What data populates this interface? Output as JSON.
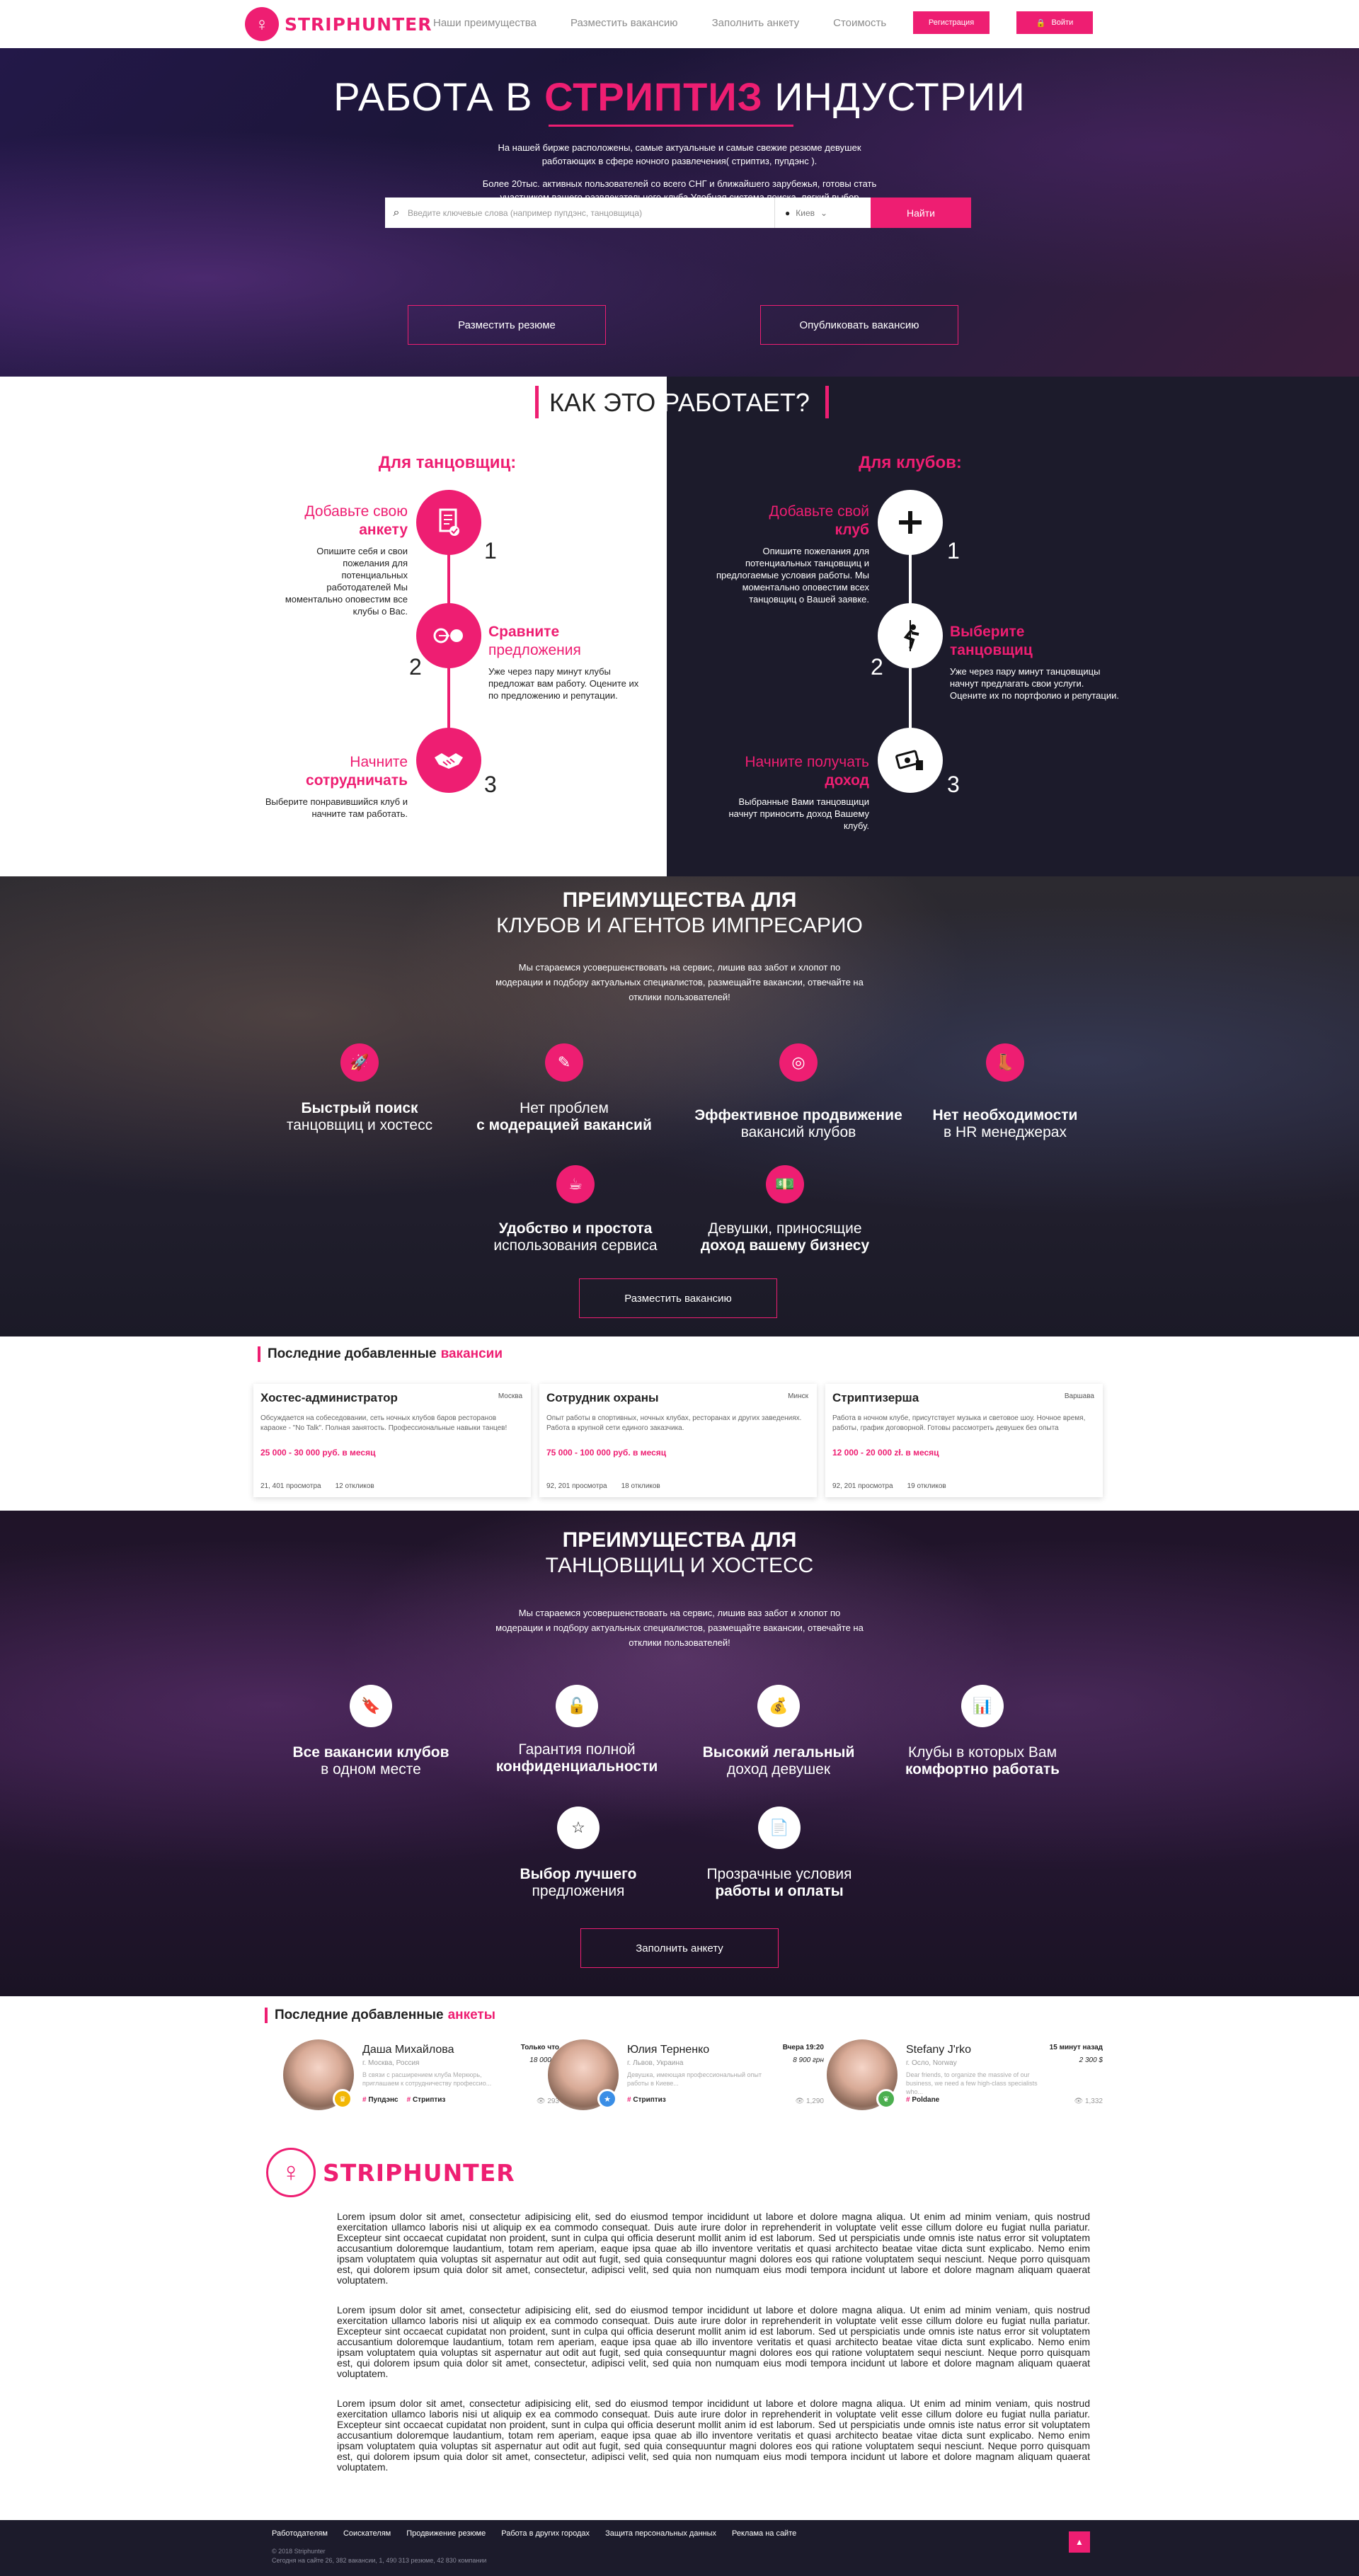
{
  "header": {
    "logo": "STRIPHUNTER",
    "nav": [
      "Наши преимущества",
      "Разместить вакансию",
      "Заполнить анкету",
      "Стоимость"
    ],
    "register": "Регистрация",
    "login": "Войти"
  },
  "hero": {
    "title_pre": "РАБОТА В",
    "title_accent": "СТРИПТИЗ",
    "title_post": "ИНДУСТРИИ",
    "p1": "На нашей бирже расположены, самые актуальные и самые свежие резюме девушек работающих в сфере ночного развлечения( стриптиз, пупдэнс ).",
    "p2": "Более 20тыс. активных пользователей со всего СНГ и ближайшего зарубежья, готовы стать участником вашего развлекательного клуба.Удобная система поиска, легкий выбор специалистов, доступная цена!",
    "search_placeholder": "Введите ключевые слова (например пупдэнс, танцовщица)",
    "city": "Киев",
    "search_button": "Найти",
    "btn_resume": "Разместить резюме",
    "btn_vacancy": "Опубликовать вакансию"
  },
  "how": {
    "title_left": "КАК ЭТО",
    "title_right": "РАБОТАЕТ?",
    "dancers_head": "Для танцовщиц:",
    "clubs_head": "Для клубов:",
    "dancers": [
      {
        "num": "1",
        "h1": "Добавьте свою",
        "h2": "анкету",
        "desc": "Опишите себя и свои пожелания для потенциальных работодателей Мы моментально оповестим все клубы о Вас."
      },
      {
        "num": "2",
        "h1": "Сравните",
        "h2": "предложения",
        "desc": "Уже через пару минут клубы предложат вам работу. Оцените их по предложению и репутации."
      },
      {
        "num": "3",
        "h1": "Начните",
        "h2": "сотрудничать",
        "desc": "Выберите понравившийся клуб и начните там работать."
      }
    ],
    "clubs": [
      {
        "num": "1",
        "h1": "Добавьте свой",
        "h2": "клуб",
        "desc": "Опишите пожелания для потенциальных танцовщиц и предлогаемые условия работы. Мы моментально оповестим всех танцовщиц о Вашей заявке."
      },
      {
        "num": "2",
        "h1": "Выберите",
        "h2": "танцовщиц",
        "desc": "Уже через пару минут танцовщицы начнут предлагать свои услуги. Оцените их по портфолио и репутации."
      },
      {
        "num": "3",
        "h1": "Начните получать",
        "h2": "доход",
        "desc": "Выбранные Вами танцовщици начнут приносить доход Вашему клубу."
      }
    ]
  },
  "adv_clubs": {
    "title_bold": "ПРЕИМУЩЕСТВА ДЛЯ",
    "title_light": "КЛУБОВ И АГЕНТОВ ИМПРЕСАРИО",
    "text": "Мы стараемся усовершенствовать на сервис, лишив ваз забот и хлопот по модерации и подбору актуальных специалистов, размещайте вакансии, отвечайте на отклики пользователей!",
    "features": [
      {
        "icon": "rocket-icon",
        "a": "Быстрый поиск",
        "b": "танцовщиц и хостесс"
      },
      {
        "icon": "pencil-icon",
        "a": "Нет проблем",
        "b": "с модерацией вакансий"
      },
      {
        "icon": "target-icon",
        "a": "Эффективное продвижение",
        "b": "вакансий клубов"
      },
      {
        "icon": "boot-icon",
        "a": "Нет необходимости",
        "b": "в HR менеджерах"
      },
      {
        "icon": "cup-icon",
        "a": "Удобство и простота",
        "b": "использования сервиса"
      },
      {
        "icon": "money-icon",
        "a": "Девушки, приносящие",
        "b": "доход вашему бизнесу"
      }
    ],
    "button": "Разместить вакансию"
  },
  "vacancies": {
    "head": "Последние добавленные",
    "head_accent": "вакансии",
    "items": [
      {
        "title": "Хостес-администратор",
        "city": "Москва",
        "desc": "Обсуждается на собеседовании, сеть ночных клубов баров ресторанов караоке - \"No Talk\". Полная занятость. Профессиональные навыки танцев!",
        "salary": "25 000 - 30 000 руб. в месяц",
        "views": "21, 401 просмотра",
        "replies": "12 откликов"
      },
      {
        "title": "Сотрудник охраны",
        "city": "Минск",
        "desc": "Опыт работы в спортивных, ночных клубах, ресторанах и других заведениях. Работа в крупной сети единого заказчика.",
        "salary": "75 000 - 100 000 руб. в месяц",
        "views": "92, 201 просмотра",
        "replies": "18 откликов"
      },
      {
        "title": "Стриптизерша",
        "city": "Варшава",
        "desc": "Работа в ночном клубе, присутствует музыка и световое шоу. Ночное время, работы, график договорной. Готовы рассмотреть девушек без опыта",
        "salary": "12 000 - 20 000 zł. в месяц",
        "views": "92, 201 просмотра",
        "replies": "19 откликов"
      }
    ]
  },
  "adv_girls": {
    "title_bold": "ПРЕИМУЩЕСТВА ДЛЯ",
    "title_light": "ТАНЦОВЩИЦ И ХОСТЕСС",
    "text": "Мы стараемся усовершенствовать на сервис, лишив ваз забот и хлопот по модерации и подбору актуальных специалистов, размещайте вакансии, отвечайте на отклики пользователей!",
    "features": [
      {
        "icon": "bookmark-icon",
        "a": "Все вакансии клубов",
        "b": "в одном месте"
      },
      {
        "icon": "lock-icon",
        "a": "Гарантия полной",
        "b": "конфиденциальности"
      },
      {
        "icon": "moneybag-icon",
        "a": "Высокий легальный",
        "b": "доход девушек"
      },
      {
        "icon": "chart-icon",
        "a": "Клубы в которых Вам",
        "b": "комфортно работать"
      },
      {
        "icon": "star-icon",
        "a": "Выбор лучшего",
        "b": "предложения"
      },
      {
        "icon": "document-icon",
        "a": "Прозрачные условия",
        "b": "работы и оплаты"
      }
    ],
    "button": "Заполнить анкету"
  },
  "profiles": {
    "head": "Последние добавленные",
    "head_accent": "анкеты",
    "items": [
      {
        "name": "Даша Михайлова",
        "time": "Только что",
        "city": "г. Москва, Россия",
        "price": "18 000 р.",
        "desc": "В связи с расширением клуба Меркюрь, приглашаем к сотрудничеству профессио...",
        "tags": [
          "Пупдэнс",
          "Стриптиз"
        ],
        "views": "293",
        "badge_color": "#f2b705",
        "badge_icon": "crown-icon"
      },
      {
        "name": "Юлия Терненко",
        "time": "Вчера 19:20",
        "city": "г. Львов, Украина",
        "price": "8 900 грн",
        "desc": "Девушка, имеющая профессиональный опыт работы в Киеве...",
        "tags": [
          "Стриптиз"
        ],
        "views": "1,290",
        "badge_color": "#3a8ee6",
        "badge_icon": "star-icon"
      },
      {
        "name": "Stefany J'rko",
        "time": "15 минут назад",
        "city": "г. Осло, Norway",
        "price": "2 300 $",
        "desc": "Dear friends, to organize the massive of our business, we need a few high-class specialists who...",
        "tags": [
          "Poldane"
        ],
        "views": "1,332",
        "badge_color": "#4caf50",
        "badge_icon": "leaf-icon"
      }
    ]
  },
  "about": {
    "logo": "STRIPHUNTER",
    "paragraphs": [
      "Lorem ipsum dolor sit amet, consectetur adipisicing elit, sed do eiusmod tempor incididunt ut labore et dolore magna aliqua. Ut enim ad minim veniam, quis nostrud exercitation ullamco laboris nisi ut aliquip ex ea commodo consequat. Duis aute irure dolor in reprehenderit in voluptate velit esse cillum dolore eu fugiat nulla pariatur. Excepteur sint occaecat cupidatat non proident, sunt in culpa qui officia deserunt mollit anim id est laborum. Sed ut perspiciatis unde omnis iste natus error sit voluptatem accusantium doloremque laudantium, totam rem aperiam, eaque ipsa quae ab illo inventore veritatis et quasi architecto beatae vitae dicta sunt explicabo. Nemo enim ipsam voluptatem quia voluptas sit aspernatur aut odit aut fugit, sed quia consequuntur magni dolores eos qui ratione voluptatem sequi nesciunt. Neque porro quisquam est, qui dolorem ipsum quia dolor sit amet, consectetur, adipisci velit, sed quia non numquam eius modi tempora incidunt ut labore et dolore magnam aliquam quaerat voluptatem.",
      "Lorem ipsum dolor sit amet, consectetur adipisicing elit, sed do eiusmod tempor incididunt ut labore et dolore magna aliqua. Ut enim ad minim veniam, quis nostrud exercitation ullamco laboris nisi ut aliquip ex ea commodo consequat. Duis aute irure dolor in reprehenderit in voluptate velit esse cillum dolore eu fugiat nulla pariatur. Excepteur sint occaecat cupidatat non proident, sunt in culpa qui officia deserunt mollit anim id est laborum. Sed ut perspiciatis unde omnis iste natus error sit voluptatem accusantium doloremque laudantium, totam rem aperiam, eaque ipsa quae ab illo inventore veritatis et quasi architecto beatae vitae dicta sunt explicabo. Nemo enim ipsam voluptatem quia voluptas sit aspernatur aut odit aut fugit, sed quia consequuntur magni dolores eos qui ratione voluptatem sequi nesciunt. Neque porro quisquam est, qui dolorem ipsum quia dolor sit amet, consectetur, adipisci velit, sed quia non numquam eius modi tempora incidunt ut labore et dolore magnam aliquam quaerat voluptatem.",
      "Lorem ipsum dolor sit amet, consectetur adipisicing elit, sed do eiusmod tempor incididunt ut labore et dolore magna aliqua. Ut enim ad minim veniam, quis nostrud exercitation ullamco laboris nisi ut aliquip ex ea commodo consequat. Duis aute irure dolor in reprehenderit in voluptate velit esse cillum dolore eu fugiat nulla pariatur. Excepteur sint occaecat cupidatat non proident, sunt in culpa qui officia deserunt mollit anim id est laborum. Sed ut perspiciatis unde omnis iste natus error sit voluptatem accusantium doloremque laudantium, totam rem aperiam, eaque ipsa quae ab illo inventore veritatis et quasi architecto beatae vitae dicta sunt explicabo. Nemo enim ipsam voluptatem quia voluptas sit aspernatur aut odit aut fugit, sed quia consequuntur magni dolores eos qui ratione voluptatem sequi nesciunt. Neque porro quisquam est, qui dolorem ipsum quia dolor sit amet, consectetur, adipisci velit, sed quia non numquam eius modi tempora incidunt ut labore et dolore magnam aliquam quaerat voluptatem."
    ]
  },
  "footer": {
    "links": [
      "Работодателям",
      "Соискателям",
      "Продвижение резюме",
      "Работа в других городах",
      "Защита персональных данных",
      "Реклама на сайте"
    ],
    "copy1": "© 2018 Striphunter",
    "copy2": "Сегодня на сайте 26, 382 вакансии, 1, 490 313 резюме, 42 830 компании",
    "up": "▲"
  },
  "colors": {
    "accent": "#ee1e72",
    "dark": "#1c1b2b"
  }
}
